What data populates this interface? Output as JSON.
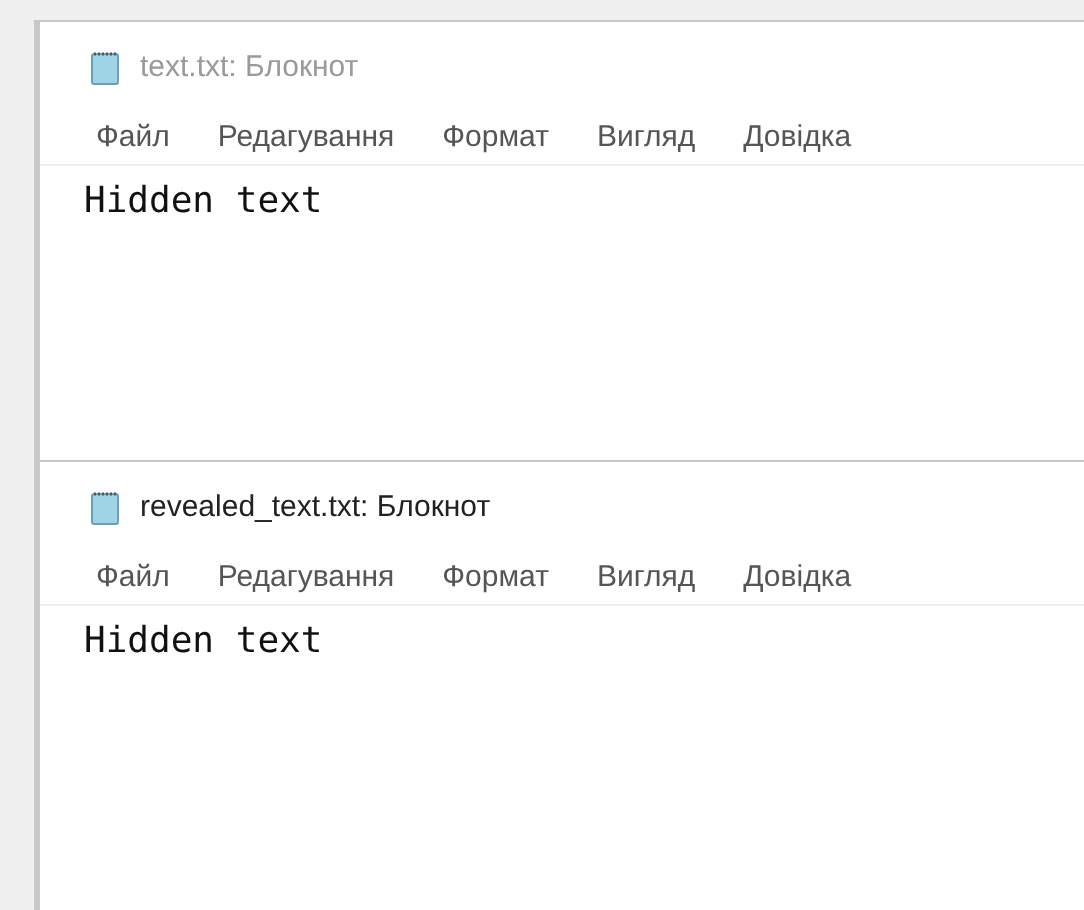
{
  "windows": [
    {
      "title": "text.txt: Блокнот",
      "active": false,
      "menu": [
        "Файл",
        "Редагування",
        "Формат",
        "Вигляд",
        "Довідка"
      ],
      "content": "Hidden text"
    },
    {
      "title": "revealed_text.txt: Блокнот",
      "active": true,
      "menu": [
        "Файл",
        "Редагування",
        "Формат",
        "Вигляд",
        "Довідка"
      ],
      "content": "Hidden text"
    }
  ]
}
